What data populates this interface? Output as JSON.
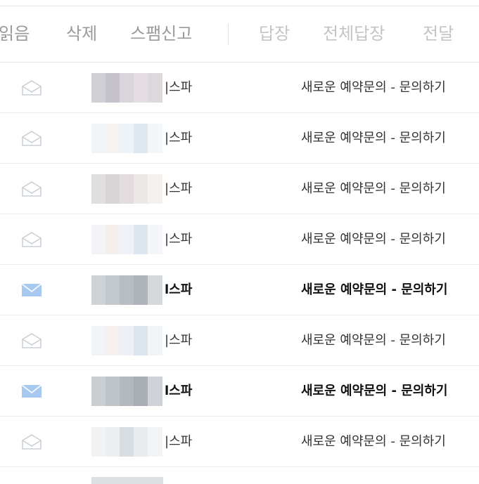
{
  "toolbar": {
    "read_label": "읽음",
    "delete_label": "삭제",
    "spam_label": "스팸신고",
    "reply_label": "답장",
    "reply_all_label": "전체답장",
    "forward_label": "전달"
  },
  "colors": {
    "unread_icon": "#a8c9ef",
    "read_icon": "#c9ced3"
  },
  "messages": [
    {
      "sender_suffix": "|스파",
      "subject": "새로운 예약문의 - 문의하기",
      "unread": false
    },
    {
      "sender_suffix": "|스파",
      "subject": "새로운 예약문의 - 문의하기",
      "unread": false
    },
    {
      "sender_suffix": "|스파",
      "subject": "새로운 예약문의 - 문의하기",
      "unread": false
    },
    {
      "sender_suffix": "|스파",
      "subject": "새로운 예약문의 - 문의하기",
      "unread": false
    },
    {
      "sender_suffix": "l스파",
      "subject": "새로운 예약문의 - 문의하기",
      "unread": true
    },
    {
      "sender_suffix": "|스파",
      "subject": "새로운 예약문의 - 문의하기",
      "unread": false
    },
    {
      "sender_suffix": "l스파",
      "subject": "새로운 예약문의 - 문의하기",
      "unread": true
    },
    {
      "sender_suffix": "|스파",
      "subject": "새로운 예약문의 - 문의하기",
      "unread": false
    }
  ]
}
